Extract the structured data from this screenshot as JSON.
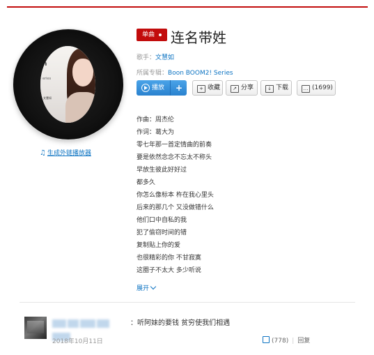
{
  "song": {
    "badge": "单曲",
    "title": "连名带姓",
    "artist_label": "歌手：",
    "artist": "文慧如",
    "album_label": "所属专辑：",
    "album": "Boon BOOM2! Series"
  },
  "cover": {
    "text_top": "n",
    "text_mid": "eries",
    "text_small": "文慧如"
  },
  "external_player": "生成外链播放器",
  "actions": {
    "play": "播放",
    "add": "+",
    "favorite": "收藏",
    "share": "分享",
    "download": "下载",
    "comments": "(1699)"
  },
  "lyrics": [
    "作曲：周杰伦",
    "作词：葛大为",
    "零七年那一首定情曲的前奏",
    "要是依然念念不忘太不称头",
    "早放生彼此好好过",
    "都多久",
    "你怎么像标本 杵在我心里头",
    "后来的那几个 又没做错什么",
    "他们口中自私的我",
    "犯了偷窃时间的错",
    "复制贴上你的爱",
    "也很精彩的你 不甘寂寞",
    "这圈子不太大 多少听说"
  ],
  "expand": "展开",
  "comment": {
    "text": "：听阿妹的要钱 贫穷使我们相遇",
    "date": "2018年10月11日",
    "likes": "(778)",
    "reply": "回复"
  },
  "colors": {
    "brand_red": "#c20c0c",
    "link_blue": "#0c73c2",
    "play_blue": "#2a82cf"
  },
  "icons": [
    "music-note-icon",
    "play-circle-icon",
    "favorite-folder-icon",
    "share-icon",
    "download-icon",
    "comment-icon",
    "thumbs-up-icon"
  ]
}
